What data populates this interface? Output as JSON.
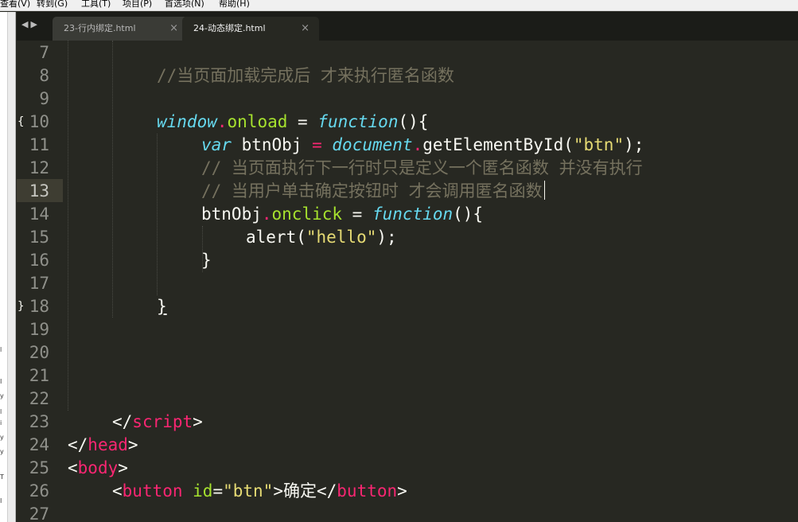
{
  "menubar": {
    "items": [
      "查看(V)",
      "转到(G)",
      "工具(T)",
      "项目(P)",
      "首选项(N)",
      "帮助(H)"
    ]
  },
  "tabs": [
    {
      "title": "23-行内绑定.html",
      "active": false
    },
    {
      "title": "24-动态绑定.html",
      "active": true
    }
  ],
  "tab_nav": {
    "left": "◀",
    "right": "▶"
  },
  "close_glyph": "×",
  "editor": {
    "current_line": 13,
    "line_numbers": [
      "7",
      "8",
      "9",
      "10",
      "11",
      "12",
      "13",
      "14",
      "15",
      "16",
      "17",
      "18",
      "19",
      "20",
      "21",
      "22",
      "23",
      "24",
      "25",
      "26",
      "27"
    ],
    "fold_open": "{",
    "fold_close": "}",
    "code": {
      "l8_comment": "//当页面加载完成后 才来执行匿名函数",
      "l10_window": "window",
      "l10_dot": ".",
      "l10_onload": "onload",
      "l10_eq": " = ",
      "l10_function": "function",
      "l10_rest": "(){",
      "l11_var": "var",
      "l11_name": " btnObj ",
      "l11_eq": "=",
      "l11_document": "document",
      "l11_dot": ".",
      "l11_call": "getElementById(",
      "l11_str": "\"btn\"",
      "l11_end": ");",
      "l12_comment": "// 当页面执行下一行时只是定义一个匿名函数 并没有执行",
      "l13_comment": "// 当用户单击确定按钮时 才会调用匿名函数",
      "l14_obj": "btnObj",
      "l14_dot": ".",
      "l14_onclick": "onclick",
      "l14_eq": " = ",
      "l14_function": "function",
      "l14_rest": "(){",
      "l15_alert": "alert(",
      "l15_str": "\"hello\"",
      "l15_end": ");",
      "l16_brace": "}",
      "l18_brace": "}",
      "l23_open": "</",
      "l23_tag": "script",
      "l23_close": ">",
      "l24_open": "</",
      "l24_tag": "head",
      "l24_close": ">",
      "l25_open": "<",
      "l25_tag": "body",
      "l25_close": ">",
      "l26_open": "<",
      "l26_tag": "button",
      "l26_attr": " id",
      "l26_eq": "=",
      "l26_val": "\"btn\"",
      "l26_gt": ">",
      "l26_text": "确定",
      "l26_endopen": "</",
      "l26_endtag": "button",
      "l26_endclose": ">"
    }
  },
  "left_strip_scraps": [
    "l",
    "I",
    "y",
    "l",
    "i",
    "y",
    "y",
    "T",
    "I"
  ],
  "colors": {
    "background": "#272822",
    "comment": "#75715e",
    "keyword": "#f92672",
    "storage": "#66d9ef",
    "entity": "#a6e22e",
    "string": "#e6db74"
  }
}
